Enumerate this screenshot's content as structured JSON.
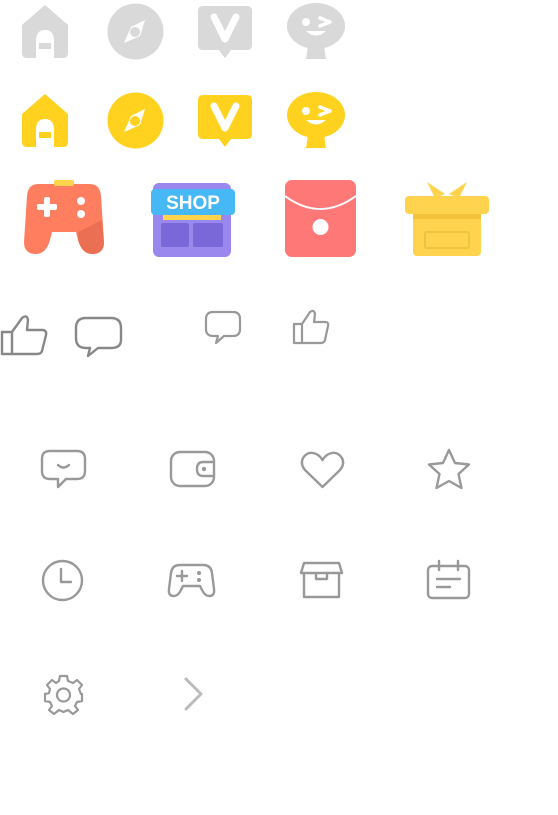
{
  "colors": {
    "inactive_gray": "#d9d9d9",
    "active_yellow": "#ffd21f",
    "game_orange": "#ff7e5f",
    "shop_purple": "#9b88ee",
    "shop_blue": "#45b8f5",
    "envelope_red": "#ff7878",
    "gift_yellow": "#ffd34d",
    "line_gray": "#999999"
  },
  "tabbar_inactive": [
    "home-icon",
    "compass-icon",
    "video-icon",
    "mascot-icon"
  ],
  "tabbar_active": [
    "home-icon",
    "compass-icon",
    "video-icon",
    "mascot-icon"
  ],
  "features": [
    {
      "icon": "gamepad-icon"
    },
    {
      "icon": "shop-icon",
      "label": "SHOP"
    },
    {
      "icon": "red-envelope-icon"
    },
    {
      "icon": "gift-icon"
    }
  ],
  "actions": [
    "thumbs-up-icon",
    "comment-icon",
    "comment-icon",
    "thumbs-up-icon"
  ],
  "line_icons": [
    "message-icon",
    "wallet-icon",
    "heart-icon",
    "star-icon",
    "clock-icon",
    "gamepad-icon",
    "box-icon",
    "calendar-icon",
    "gear-icon",
    "chevron-right-icon"
  ]
}
